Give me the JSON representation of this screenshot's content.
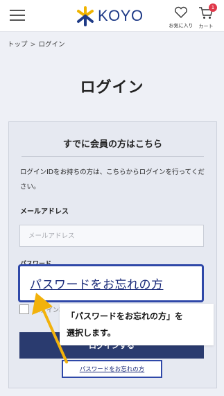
{
  "header": {
    "logo_text": "KOYO",
    "favorites_label": "お気に入り",
    "cart_label": "カート",
    "cart_count": "1",
    "icons": {
      "menu": "hamburger-menu-icon",
      "favorites": "heart-icon",
      "cart": "cart-icon"
    }
  },
  "breadcrumb": {
    "items": [
      "トップ",
      "ログイン"
    ],
    "separator": ">"
  },
  "page": {
    "title": "ログイン"
  },
  "login_card": {
    "title": "すでに会員の方はこちら",
    "description": "ログインIDをお持ちの方は、こちらからログインを行ってください。",
    "email_label": "メールアドレス",
    "email_placeholder": "メールアドレス",
    "password_label": "パスワード",
    "remember_label": "ログイン状態を保持する",
    "login_button": "ログインする",
    "forgot_link": "パスワードをお忘れの方"
  },
  "annotation": {
    "zoom_text": "パスワードをお忘れの方",
    "callout_line1": "「パスワードをお忘れの方」を",
    "callout_line2": "選択します。",
    "accent_color": "#2f48a8",
    "arrow_color": "#f2b20c"
  }
}
